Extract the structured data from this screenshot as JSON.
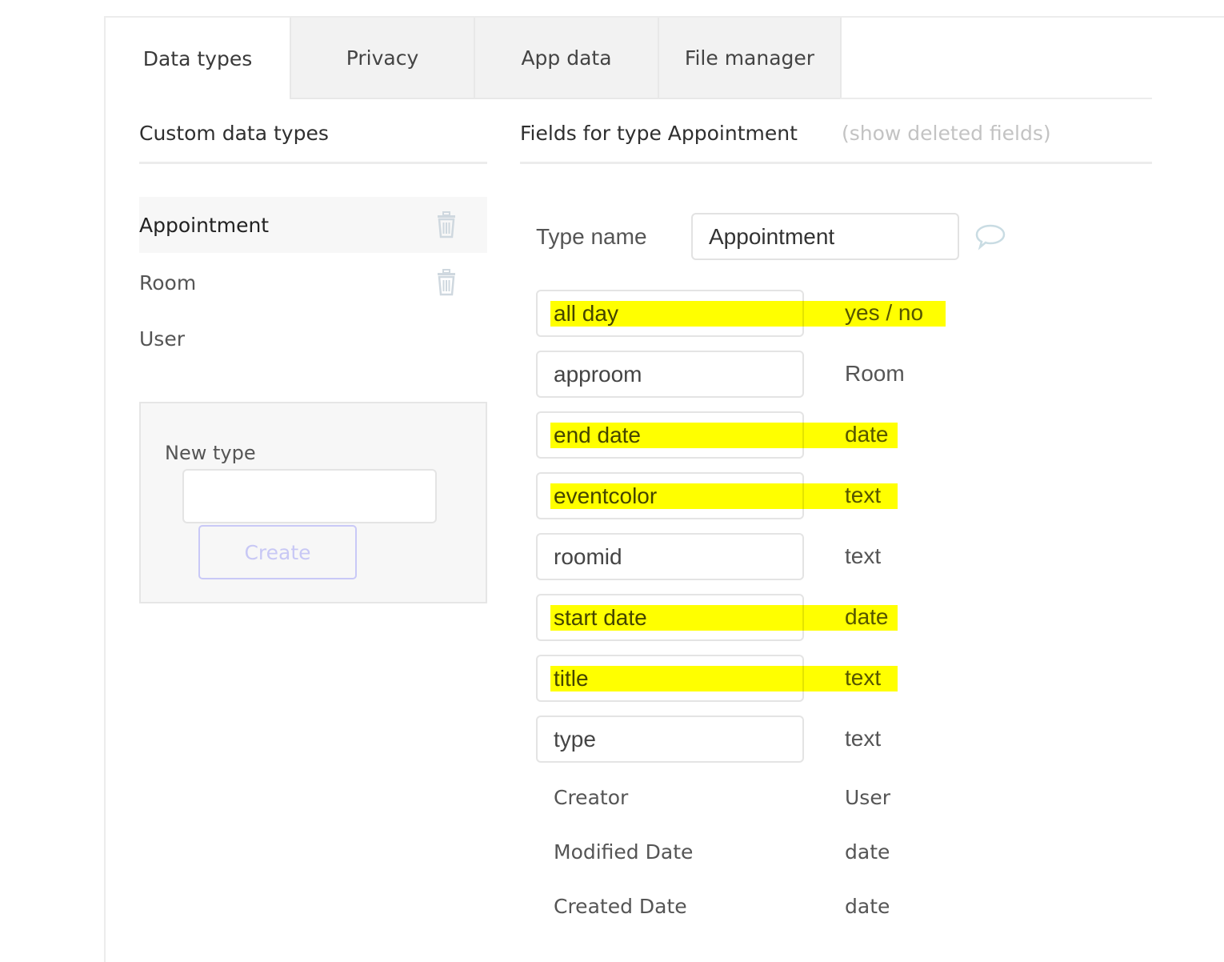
{
  "tabs": [
    {
      "label": "Data types",
      "active": true
    },
    {
      "label": "Privacy",
      "active": false
    },
    {
      "label": "App data",
      "active": false
    },
    {
      "label": "File manager",
      "active": false
    }
  ],
  "left": {
    "title": "Custom data types",
    "types": [
      {
        "name": "Appointment",
        "selected": true,
        "deletable": true
      },
      {
        "name": "Room",
        "selected": false,
        "deletable": true
      },
      {
        "name": "User",
        "selected": false,
        "deletable": false
      }
    ],
    "new_type": {
      "label": "New type",
      "input_value": "",
      "create_label": "Create"
    }
  },
  "right": {
    "title": "Fields for type Appointment",
    "show_deleted_link": "(show deleted fields)",
    "type_name_label": "Type name",
    "type_name_value": "Appointment",
    "fields": [
      {
        "name": "all day",
        "type": "yes / no",
        "highlighted": true
      },
      {
        "name": "approom",
        "type": "Room",
        "highlighted": false
      },
      {
        "name": "end date",
        "type": "date",
        "highlighted": true
      },
      {
        "name": "eventcolor",
        "type": "text",
        "highlighted": true
      },
      {
        "name": "roomid",
        "type": "text",
        "highlighted": false
      },
      {
        "name": "start date",
        "type": "date",
        "highlighted": true
      },
      {
        "name": "title",
        "type": "text",
        "highlighted": true
      },
      {
        "name": "type",
        "type": "text",
        "highlighted": false
      }
    ],
    "builtin_fields": [
      {
        "name": "Creator",
        "type": "User"
      },
      {
        "name": "Modified Date",
        "type": "date"
      },
      {
        "name": "Created Date",
        "type": "date"
      }
    ]
  },
  "colors": {
    "highlight": "#ffff00",
    "create_button": "#c9c9f7",
    "tab_inactive_bg": "#f2f2f2"
  }
}
